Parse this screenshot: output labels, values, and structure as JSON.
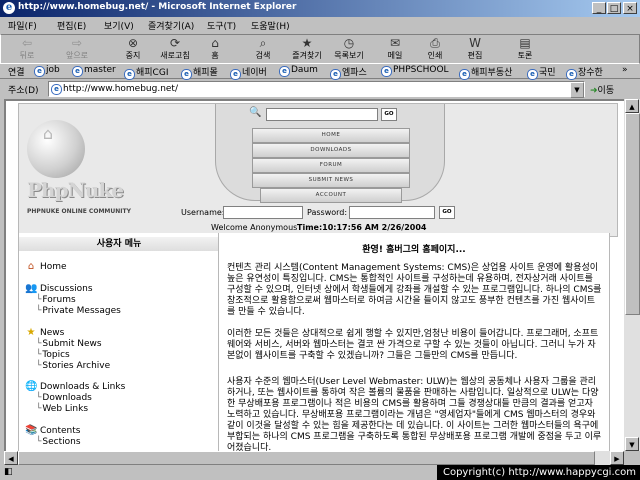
{
  "window": {
    "title": "http://www.homebug.net/ - Microsoft Internet Explorer"
  },
  "menu": [
    "파일(F)",
    "편집(E)",
    "보기(V)",
    "즐겨찾기(A)",
    "도구(T)",
    "도움말(H)"
  ],
  "toolbar": {
    "back": "뒤로",
    "forward": "앞으로",
    "stop": "중지",
    "refresh": "새로고침",
    "home": "홈",
    "search": "검색",
    "favorites": "즐겨찾기",
    "history": "목록보기",
    "mail": "메일",
    "print": "인쇄",
    "edit": "편집",
    "discuss": "토론"
  },
  "links": {
    "label": "연결",
    "items": [
      "job",
      "master",
      "해피CGI",
      "해피몰",
      "네이버",
      "Daum",
      "엠파스",
      "PHPSCHOOL",
      "해피부동산",
      "국민",
      "장수한"
    ]
  },
  "address": {
    "label": "주소(D)",
    "url": "http://www.homebug.net/",
    "go": "이동"
  },
  "site": {
    "logo": "PhpNuke",
    "logo_sub": "PHPNUKE ONLINE COMMUNITY",
    "search_go": "GO",
    "nav": [
      "HOME",
      "DOWNLOADS",
      "FORUM",
      "SUBMIT NEWS",
      "ACCOUNT"
    ],
    "username_label": "Username:",
    "password_label": "Password:",
    "login_go": "GO",
    "welcome": "Welcome Anonymous",
    "time": "Time:10:17:56 AM 2/26/2004"
  },
  "sidebar": {
    "title": "사용자 메뉴",
    "home": "Home",
    "discussions": "Discussions",
    "forums": "Forums",
    "private_messages": "Private Messages",
    "news": "News",
    "submit_news": "Submit News",
    "topics": "Topics",
    "stories_archive": "Stories Archive",
    "downloads_links": "Downloads & Links",
    "downloads": "Downloads",
    "web_links": "Web Links",
    "contents": "Contents",
    "sections": "Sections"
  },
  "article": {
    "title": "환영! 홈버그의 홈페이지...",
    "p1": "컨텐츠 관리 시스템(Content Management Systems: CMS)은 상업용 사이트 운영에 활용성이 높은 유연성이 특징입니다. CMS는 통합적인 사이트를 구성하는데 유용하며, 전자상거래 사이트를 구성할 수 있으며, 인터넷 상에서 학생들에게 강좌를 개설할 수 있는 프로그램입니다. 하나의 CMS를 창조적으로 활용함으로써 웹마스터로 하여금 시간을 들이지 않고도 풍부한 컨텐츠를 가진 웹사이트를 만들 수 있습니다.",
    "p2": "이러한 모든 것들은 상대적으로 쉽게 행할 수 있지만,엄청난 비용이 들어갑니다. 프로그래머, 소프트웨어와 서비스, 서버와 웹마스터는 결코 싼 가격으로 구할 수 있는 것들이 아닙니다. 그러니 누가 자본없이 웹사이트를 구축할 수 있겠습니까? 그들은 그들만의 CMS를 만듭니다.",
    "p3": "사용자 수준의 웹마스터(User Level Webmaster: ULW)는 웹상의 공동체나 사용자 그룹을 관리하거나, 또는 웹사이트를 통하여 작은 볼륨의 물품을 판매하는 사람입니다. 일상적으로 ULW는 다양한 무상배포용 프로그램이나 적은 비용의 CMS를 활용하며 그들 경쟁상대들 만큼의 결과를 얻고자 노력하고 있습니다. 무상배포용 프로그램이라는 개념은 \"영세업자\"들에게 CMS 웹마스터의 경우와 같이 이것을 달성할 수 있는 힘을 제공한다는 데 있습니다. 이 사이트는 그러한 웹마스터들의 욕구에 부합되는 하나의 CMS 프로그램을 구축하도록 통합된 무상배포용 프로그램 개발에 중점을 두고 이루어졌습니다."
  },
  "status": {
    "copyright": "Copyright(c) http://www.happycgi.com"
  }
}
